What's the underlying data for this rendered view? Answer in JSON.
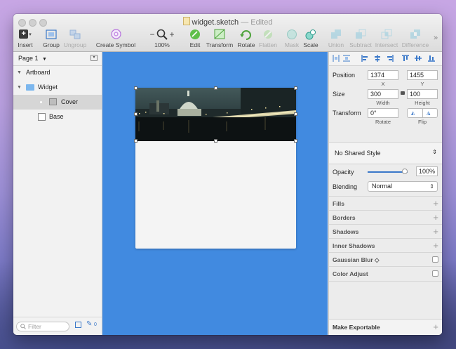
{
  "window": {
    "title": "widget.sketch",
    "status": "Edited"
  },
  "toolbar": {
    "insert": "Insert",
    "group": "Group",
    "ungroup": "Ungroup",
    "create_symbol": "Create Symbol",
    "zoom_minus": "−",
    "zoom_plus": "+",
    "zoom_level": "100%",
    "edit": "Edit",
    "transform": "Transform",
    "rotate": "Rotate",
    "flatten": "Flatten",
    "mask": "Mask",
    "scale": "Scale",
    "union": "Union",
    "subtract": "Subtract",
    "intersect": "Intersect",
    "difference": "Difference",
    "more": "»"
  },
  "layers": {
    "page": "Page 1",
    "items": [
      {
        "label": "Artboard"
      },
      {
        "label": "Widget"
      },
      {
        "label": "Cover"
      },
      {
        "label": "Base"
      }
    ],
    "filter_placeholder": "Filter",
    "count": "0"
  },
  "inspector": {
    "position_label": "Position",
    "x_value": "1374",
    "y_value": "1455",
    "x_label": "X",
    "y_label": "Y",
    "size_label": "Size",
    "width_value": "300",
    "height_value": "100",
    "width_label": "Width",
    "height_label": "Height",
    "transform_label": "Transform",
    "rotate_value": "0°",
    "rotate_label": "Rotate",
    "flip_label": "Flip",
    "shared_style": "No Shared Style",
    "opacity_label": "Opacity",
    "opacity_value": "100%",
    "opacity_fraction": 1.0,
    "blending_label": "Blending",
    "blending_value": "Normal",
    "sections": [
      {
        "label": "Fills",
        "control": "plus"
      },
      {
        "label": "Borders",
        "control": "plus"
      },
      {
        "label": "Shadows",
        "control": "plus"
      },
      {
        "label": "Inner Shadows",
        "control": "plus"
      },
      {
        "label": "Gaussian Blur ◇",
        "control": "check"
      },
      {
        "label": "Color Adjust",
        "control": "check"
      }
    ],
    "export_label": "Make Exportable"
  },
  "colors": {
    "canvas": "#418ae0",
    "selection": "#d6d6d6"
  }
}
